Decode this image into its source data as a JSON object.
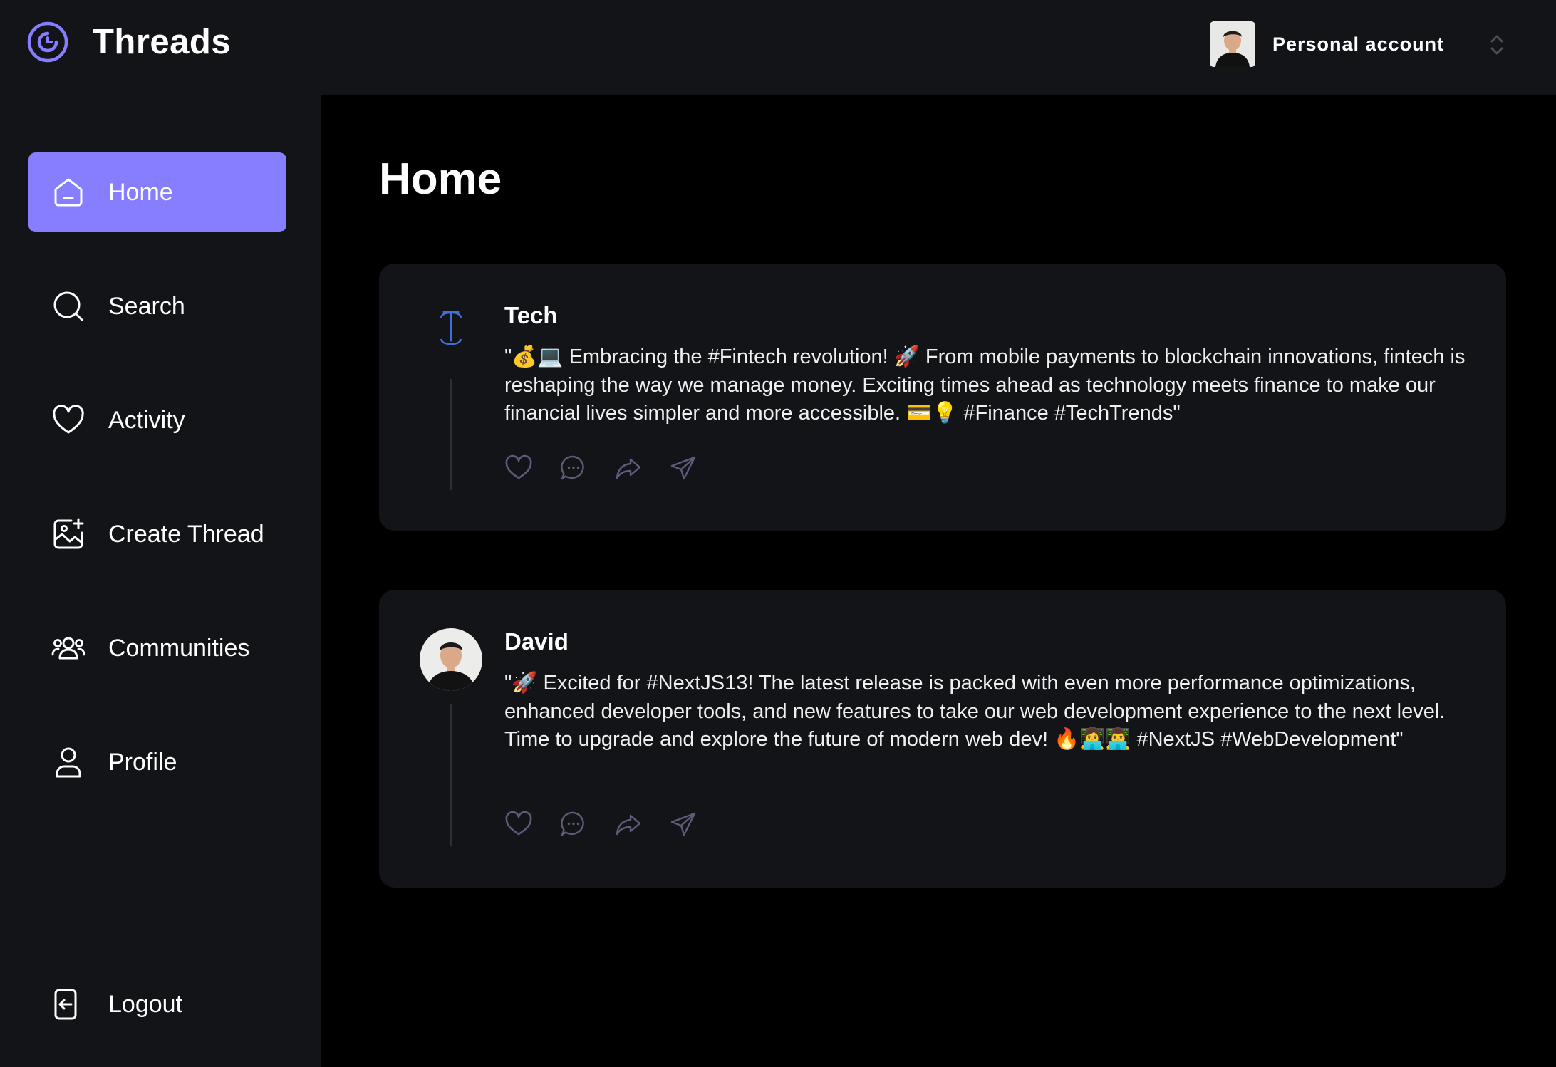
{
  "app": {
    "title": "Threads"
  },
  "account": {
    "label": "Personal account"
  },
  "sidebar": {
    "items": [
      {
        "label": "Home",
        "icon": "home-icon",
        "active": true
      },
      {
        "label": "Search",
        "icon": "search-icon",
        "active": false
      },
      {
        "label": "Activity",
        "icon": "heart-icon",
        "active": false
      },
      {
        "label": "Create Thread",
        "icon": "image-add-icon",
        "active": false
      },
      {
        "label": "Communities",
        "icon": "community-icon",
        "active": false
      },
      {
        "label": "Profile",
        "icon": "user-icon",
        "active": false
      }
    ],
    "logout": {
      "label": "Logout",
      "icon": "logout-icon"
    }
  },
  "main": {
    "title": "Home",
    "threads": [
      {
        "author": "Tech",
        "text": "\"💰💻 Embracing the #Fintech revolution! 🚀 From mobile payments to blockchain innovations, fintech is reshaping the way we manage money. Exciting times ahead as technology meets finance to make our financial lives simpler and more accessible. 💳💡 #Finance #TechTrends\"",
        "avatar": "tech-logo-icon"
      },
      {
        "author": "David",
        "text": "\"🚀 Excited for #NextJS13! The latest release is packed with even more performance optimizations, enhanced developer tools, and new features to take our web development experience to the next level. Time to upgrade and explore the future of modern web dev! 🔥👩‍💻👨‍💻 #NextJS #WebDevelopment\"",
        "avatar": "user-photo"
      }
    ]
  },
  "colors": {
    "accent": "#877eff",
    "panel": "#121417",
    "background": "#000000",
    "thread_line": "#2c2f36",
    "action_icon": "#5c5c7b",
    "tech_logo": "#3f6fd8"
  }
}
